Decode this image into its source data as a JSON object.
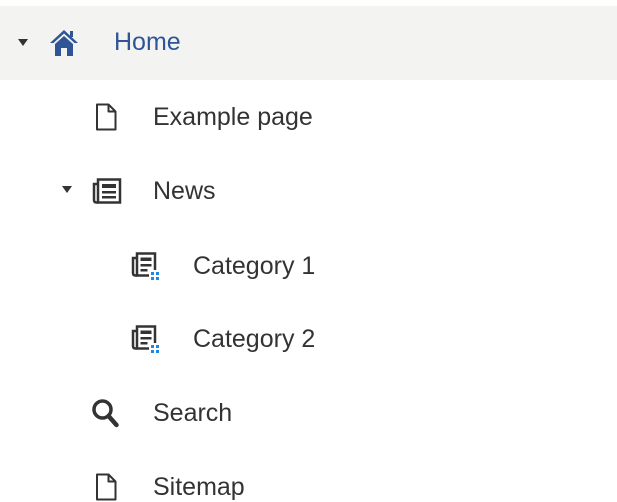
{
  "tree": {
    "home": {
      "label": "Home",
      "expanded": true,
      "selected": true,
      "icon": "home-icon"
    },
    "example_page": {
      "label": "Example page",
      "icon": "page-icon"
    },
    "news": {
      "label": "News",
      "expanded": true,
      "icon": "news-icon"
    },
    "category_1": {
      "label": "Category 1",
      "icon": "news-category-icon"
    },
    "category_2": {
      "label": "Category 2",
      "icon": "news-category-icon"
    },
    "search": {
      "label": "Search",
      "icon": "search-icon"
    },
    "sitemap": {
      "label": "Sitemap",
      "icon": "page-icon"
    }
  },
  "colors": {
    "selected_background": "#f3f3f2",
    "selected_text": "#2f5597",
    "text": "#333333",
    "accent_dots": "#1e88e5"
  }
}
